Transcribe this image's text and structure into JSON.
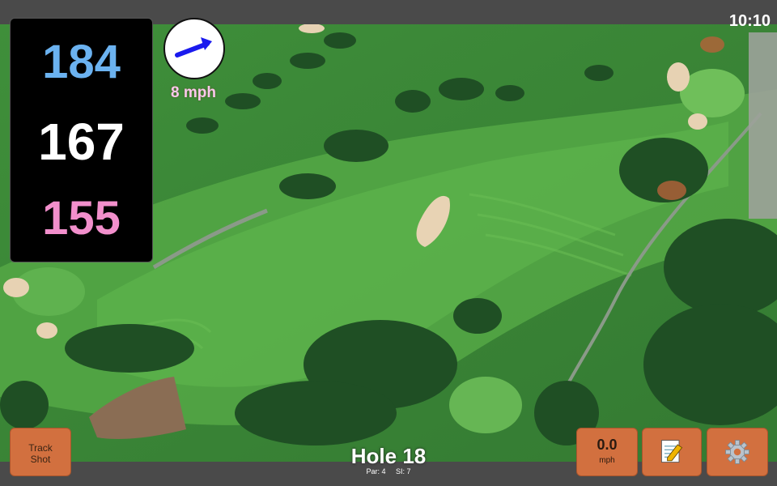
{
  "status": {
    "time": "10:10"
  },
  "distances": {
    "back": "184",
    "middle": "167",
    "front": "155"
  },
  "wind": {
    "speed_label": "8 mph"
  },
  "buttons": {
    "track_line1": "Track",
    "track_line2": "Shot",
    "speed_value": "0.0",
    "speed_unit": "mph",
    "notes_icon": "notepad-icon",
    "settings_icon": "gear-icon"
  },
  "hole": {
    "title": "Hole 18",
    "par": "Par: 4",
    "si": "SI: 7"
  },
  "colors": {
    "back": "#6bb2f0",
    "front": "#f28fcc",
    "button": "#d2703f",
    "fairway": "#4fa33f",
    "rough": "#3a8a36"
  }
}
